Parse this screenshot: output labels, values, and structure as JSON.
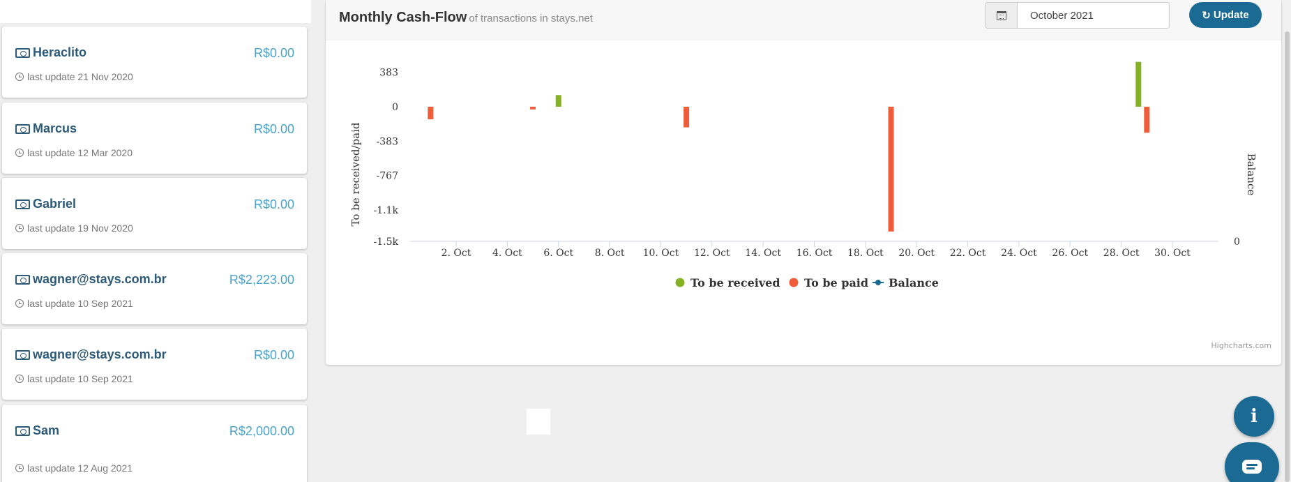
{
  "accounts": [
    {
      "name": "Heraclito",
      "amount": "R$0.00",
      "updated": "last update 21 Nov 2020"
    },
    {
      "name": "Marcus",
      "amount": "R$0.00",
      "updated": "last update 12 Mar 2020"
    },
    {
      "name": "Gabriel",
      "amount": "R$0.00",
      "updated": "last update 19 Nov 2020"
    },
    {
      "name": "wagner@stays.com.br",
      "amount": "R$2,223.00",
      "updated": "last update 10 Sep 2021"
    },
    {
      "name": "wagner@stays.com.br",
      "amount": "R$0.00",
      "updated": "last update 10 Sep 2021"
    },
    {
      "name": "Sam",
      "amount": "R$2,000.00",
      "updated": "last update 12 Aug 2021"
    }
  ],
  "panel": {
    "title": "Monthly Cash-Flow",
    "subtitle": "of transactions in stays.net",
    "month_value": "October 2021",
    "update_label": "Update",
    "icons": {
      "calendar": "calendar-icon",
      "refresh": "refresh-icon",
      "account": "money-icon",
      "clock": "clock-icon"
    }
  },
  "chart_data": {
    "type": "bar",
    "y_left_title": "To be received/paid",
    "y_right_title": "Balance",
    "y_ticks": [
      383,
      0,
      -383,
      -767,
      -1150,
      -1500
    ],
    "y_tick_labels": [
      "383",
      "0",
      "-383",
      "-767",
      "-1.1k",
      "-1.5k"
    ],
    "y_right_ticks": [
      "0"
    ],
    "ylim": [
      -1500,
      510
    ],
    "x_ticks": [
      2,
      4,
      6,
      8,
      10,
      12,
      14,
      16,
      18,
      20,
      22,
      24,
      26,
      28,
      30
    ],
    "x_tick_labels": [
      "2. Oct",
      "4. Oct",
      "6. Oct",
      "8. Oct",
      "10. Oct",
      "12. Oct",
      "14. Oct",
      "16. Oct",
      "18. Oct",
      "20. Oct",
      "22. Oct",
      "24. Oct",
      "26. Oct",
      "28. Oct",
      "30. Oct"
    ],
    "xlim": [
      0.2,
      31.8
    ],
    "series": [
      {
        "name": "To be received",
        "color": "#86b124",
        "points": [
          [
            6,
            130
          ],
          [
            29,
            500
          ]
        ]
      },
      {
        "name": "To be paid",
        "color": "#ee5c3a",
        "points": [
          [
            1,
            -140
          ],
          [
            5,
            -30
          ],
          [
            11,
            -230
          ],
          [
            19,
            -1390
          ],
          [
            29,
            -290
          ]
        ]
      },
      {
        "name": "Balance",
        "color": "#1a6a93",
        "points": []
      }
    ],
    "legend_position": "bottom-center",
    "credit": "Highcharts.com"
  },
  "widgets": {
    "info_icon": "info-icon",
    "chat_icon": "chat-icon"
  }
}
